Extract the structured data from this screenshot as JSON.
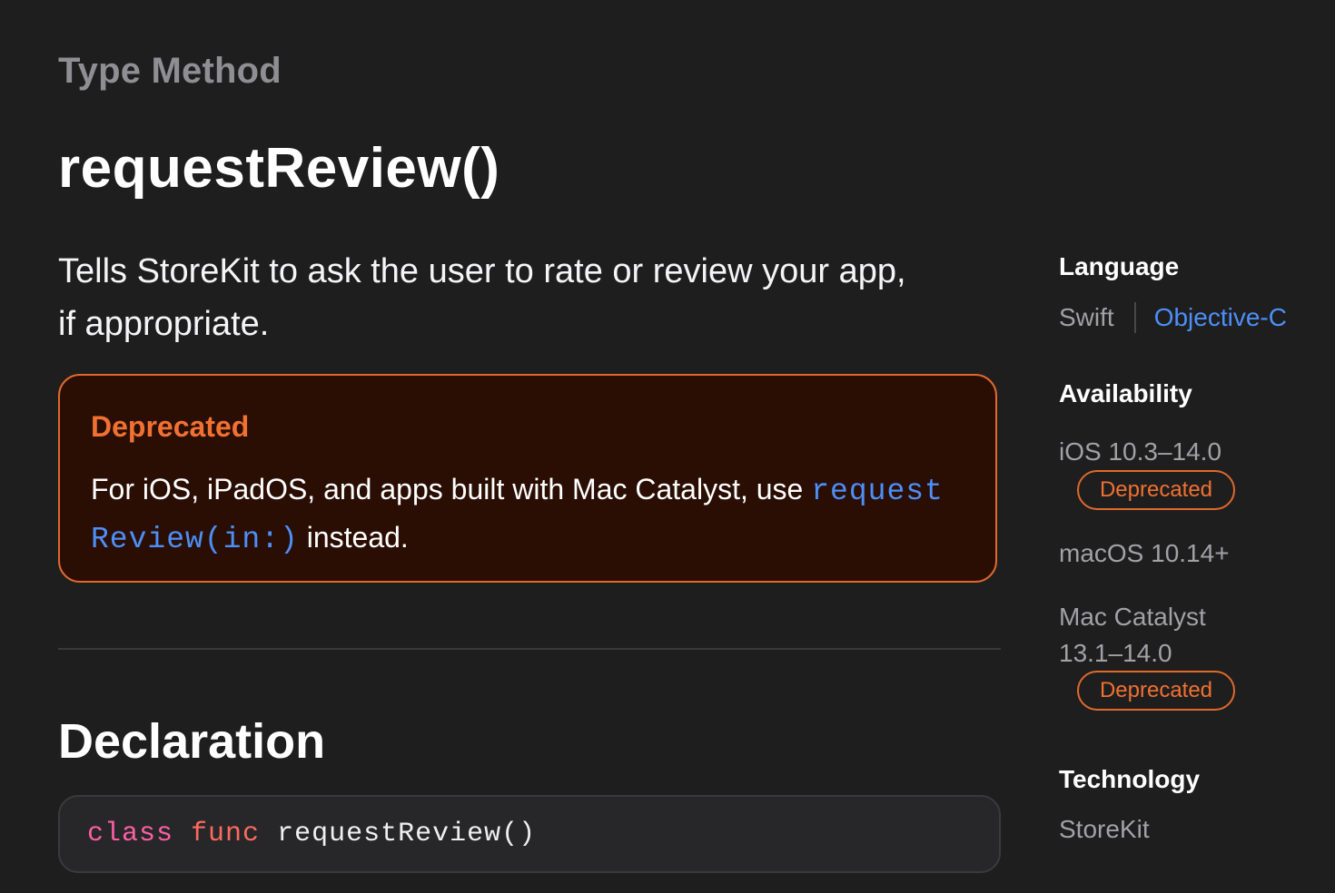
{
  "header": {
    "eyebrow": "Type Method",
    "title": "requestReview()"
  },
  "abstract": {
    "line1": "Tells StoreKit to ask the user to rate or review your app,",
    "line2": "if appropriate."
  },
  "deprecation": {
    "title": "Deprecated",
    "text_before": "For iOS, iPadOS, and apps built with Mac Catalyst, use ",
    "link_part1": "request",
    "link_part2": "Review(in:)",
    "text_after": " instead.",
    "accent_color": "#e0692c"
  },
  "declaration": {
    "heading": "Declaration",
    "keyword_class": "class",
    "keyword_func": "func",
    "signature": "requestReview()"
  },
  "sidebar": {
    "language": {
      "heading": "Language",
      "options": [
        "Swift",
        "Objective-C"
      ]
    },
    "availability": {
      "heading": "Availability",
      "platforms": [
        {
          "name": "iOS 10.3–14.0",
          "badge": "Deprecated"
        },
        {
          "name": "macOS 10.14+",
          "badge": ""
        },
        {
          "name_line1": "Mac Catalyst",
          "name_line2": "13.1–14.0",
          "badge": "Deprecated"
        }
      ]
    },
    "technology": {
      "heading": "Technology",
      "value": "StoreKit"
    }
  },
  "colors": {
    "background": "#1e1e1f",
    "link": "#4c8ff6",
    "deprecated": "#f07131"
  }
}
